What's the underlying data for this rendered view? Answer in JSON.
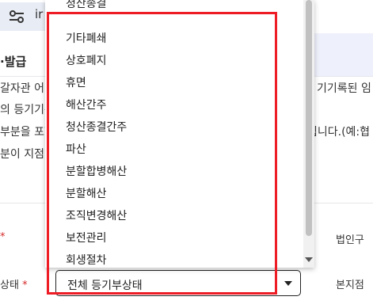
{
  "browser": {
    "url_fragment": "ir"
  },
  "nav": {
    "issue_label": "·발급"
  },
  "background_text": {
    "line1_left": "갈자관  어",
    "line1_right": "기기록된 임",
    "line2_left": "의 등기기록",
    "line3_left": "부분을 포함",
    "line3_right": "됩니다.(예:협",
    "line4_left": "분이 지점일"
  },
  "form": {
    "required_mark": "*",
    "status_label": "상태",
    "right_label_1": "법인구",
    "right_label_2": "본지점",
    "status_select_value": "전체 등기부상태"
  },
  "dropdown": {
    "partial_top": "청산종결",
    "options": [
      "기타폐쇄",
      "상호폐지",
      "휴면",
      "해산간주",
      "청산종결간주",
      "파산",
      "분할합병해산",
      "분할해산",
      "조직변경해산",
      "보전관리",
      "회생절차"
    ]
  },
  "colors": {
    "highlight_frame": "#ee1c25",
    "nav_bg": "#eef0fb"
  },
  "icons": {
    "site_info": "tune-icon",
    "nav_dropdown": "chevron-down-icon"
  }
}
